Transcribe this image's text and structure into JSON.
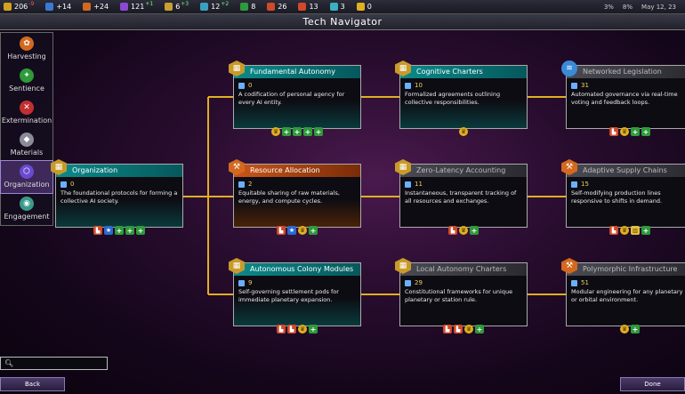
{
  "topbar": {
    "resources": [
      {
        "icon": "gold-coin-icon",
        "color": "#d4a020",
        "value": "206",
        "delta": "-9",
        "delta_type": "neg"
      },
      {
        "icon": "people-icon",
        "color": "#3a7ad0",
        "value": "+14",
        "delta": "",
        "delta_type": ""
      },
      {
        "icon": "hammer-icon",
        "color": "#d2691e",
        "value": "+24",
        "delta": "",
        "delta_type": ""
      },
      {
        "icon": "research-icon",
        "color": "#8a4ad0",
        "value": "121",
        "delta": "+1",
        "delta_type": "pos"
      },
      {
        "icon": "influence-icon",
        "color": "#c8a030",
        "value": "6",
        "delta": "+3",
        "delta_type": "pos"
      },
      {
        "icon": "science-icon",
        "color": "#3aa0c0",
        "value": "12",
        "delta": "+2",
        "delta_type": "pos"
      },
      {
        "icon": "shield-icon",
        "color": "#2e9a3a",
        "value": "8",
        "delta": "",
        "delta_type": ""
      },
      {
        "icon": "factory-icon",
        "color": "#d04a2a",
        "value": "26",
        "delta": "",
        "delta_type": ""
      },
      {
        "icon": "factory-alt-icon",
        "color": "#d04a2a",
        "value": "13",
        "delta": "",
        "delta_type": ""
      },
      {
        "icon": "cube-icon",
        "color": "#3ab0c0",
        "value": "3",
        "delta": "",
        "delta_type": ""
      },
      {
        "icon": "star-coin-icon",
        "color": "#e0b020",
        "value": "0",
        "delta": "",
        "delta_type": ""
      }
    ],
    "right": {
      "stat1": "3%",
      "stat2": "8%",
      "date": "May 12, 23"
    }
  },
  "title": "Tech Navigator",
  "sidebar": {
    "items": [
      {
        "label": "Harvesting",
        "icon": "harvest-icon",
        "color": "#d2691e"
      },
      {
        "label": "Sentience",
        "icon": "sentience-icon",
        "color": "#2e9a3a"
      },
      {
        "label": "Extermination",
        "icon": "extermination-icon",
        "color": "#c03030"
      },
      {
        "label": "Materials",
        "icon": "materials-icon",
        "color": "#8a8a9a"
      },
      {
        "label": "Organization",
        "icon": "organization-icon",
        "color": "#6a4ad0"
      },
      {
        "label": "Engagement",
        "icon": "engagement-icon",
        "color": "#3a9a8a"
      }
    ]
  },
  "nodes": [
    {
      "name": "Organization",
      "cost": "0",
      "desc": "The foundational protocols for forming a collective AI society.",
      "style": "teal",
      "badge": "gold",
      "unlocks": [
        "fac",
        "star",
        "plus",
        "plus",
        "plus"
      ]
    },
    {
      "name": "Fundamental Autonomy",
      "cost": "0",
      "desc": "A codification of personal agency for every AI entity.",
      "style": "teal",
      "badge": "gold",
      "unlocks": [
        "crown",
        "plus",
        "plus",
        "plus",
        "plus"
      ]
    },
    {
      "name": "Resource Allocation",
      "cost": "2",
      "desc": "Equitable sharing of raw materials, energy, and compute cycles.",
      "style": "orange",
      "badge": "orng",
      "unlocks": [
        "fac",
        "star",
        "crown",
        "plus"
      ]
    },
    {
      "name": "Autonomous Colony Modules",
      "cost": "9",
      "desc": "Self-governing settlement pods for immediate planetary expansion.",
      "style": "teal",
      "badge": "gold",
      "unlocks": [
        "fac",
        "fac",
        "crown",
        "plus"
      ]
    },
    {
      "name": "Cognitive Charters",
      "cost": "10",
      "desc": "Formalized agreements outlining collective responsibilities.",
      "style": "teal",
      "badge": "gold",
      "unlocks": [
        "crown"
      ]
    },
    {
      "name": "Zero-Latency Accounting",
      "cost": "11",
      "desc": "Instantaneous, transparent tracking of all resources and exchanges.",
      "style": "grey",
      "badge": "gold",
      "unlocks": [
        "fac",
        "crown",
        "plus"
      ]
    },
    {
      "name": "Local Autonomy Charters",
      "cost": "29",
      "desc": "Constitutional frameworks for unique planetary or station rule.",
      "style": "grey",
      "badge": "gold",
      "unlocks": [
        "fac",
        "fac",
        "crown",
        "plus"
      ]
    },
    {
      "name": "Networked Legislation",
      "cost": "31",
      "desc": "Automated governance via real-time voting and feedback loops.",
      "style": "grey",
      "badge": "blue",
      "unlocks": [
        "fac",
        "crown",
        "plus",
        "plus"
      ]
    },
    {
      "name": "Adaptive Supply Chains",
      "cost": "15",
      "desc": "Self-modifying production lines responsive to shifts in demand.",
      "style": "grey",
      "badge": "orng",
      "unlocks": [
        "fac",
        "crown",
        "bank",
        "plus"
      ]
    },
    {
      "name": "Polymorphic Infrastructure",
      "cost": "51",
      "desc": "Modular engineering for any planetary or orbital environment.",
      "style": "grey",
      "badge": "orng",
      "unlocks": [
        "crown",
        "plus"
      ]
    }
  ],
  "search": {
    "placeholder": ""
  },
  "buttons": {
    "back": "Back",
    "done": "Done"
  }
}
